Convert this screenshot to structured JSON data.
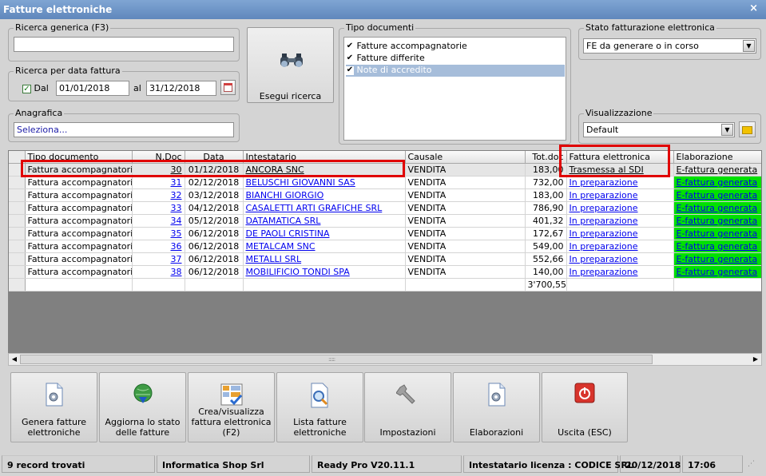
{
  "window": {
    "title": "Fatture elettroniche",
    "close_glyph": "×"
  },
  "search": {
    "generic_label": "Ricerca generica (F3)",
    "generic_value": "",
    "date_label": "Ricerca per data fattura",
    "date_from_label": "Dal",
    "date_from_checked": true,
    "date_from": "01/01/2018",
    "date_to_label": "al",
    "date_to": "31/12/2018",
    "anagrafica_label": "Anagrafica",
    "anagrafica_value": "Seleziona...",
    "search_button": "Esegui ricerca"
  },
  "tipo_documenti": {
    "label": "Tipo documenti",
    "items": [
      {
        "label": "Fatture accompagnatorie",
        "checked": true,
        "selected": false
      },
      {
        "label": "Fatture differite",
        "checked": true,
        "selected": false
      },
      {
        "label": "Note di accredito",
        "checked": true,
        "selected": true
      }
    ]
  },
  "stato": {
    "label": "Stato fatturazione elettronica",
    "value": "FE da generare o in corso"
  },
  "visualizzazione": {
    "label": "Visualizzazione",
    "value": "Default"
  },
  "grid": {
    "columns": [
      "Tipo documento",
      "N.Doc",
      "Data",
      "Intestatario",
      "Causale",
      "Tot.doc",
      "Fattura elettronica",
      "Elaborazione"
    ],
    "rows": [
      {
        "tipo": "Fattura accompagnatoria",
        "ndoc": "30",
        "data": "01/12/2018",
        "intestatario": "ANCORA SNC",
        "causale": "VENDITA",
        "tot": "183,00",
        "fe": "Trasmessa al SDI",
        "elab": "E-fattura generata"
      },
      {
        "tipo": "Fattura accompagnatoria",
        "ndoc": "31",
        "data": "02/12/2018",
        "intestatario": "BELUSCHI GIOVANNI SAS",
        "causale": "VENDITA",
        "tot": "732,00",
        "fe": "In preparazione",
        "elab": "E-fattura generata"
      },
      {
        "tipo": "Fattura accompagnatoria",
        "ndoc": "32",
        "data": "03/12/2018",
        "intestatario": "BIANCHI GIORGIO",
        "causale": "VENDITA",
        "tot": "183,00",
        "fe": "In preparazione",
        "elab": "E-fattura generata"
      },
      {
        "tipo": "Fattura accompagnatoria",
        "ndoc": "33",
        "data": "04/12/2018",
        "intestatario": "CASALETTI ARTI GRAFICHE SRL",
        "causale": "VENDITA",
        "tot": "786,90",
        "fe": "In preparazione",
        "elab": "E-fattura generata"
      },
      {
        "tipo": "Fattura accompagnatoria",
        "ndoc": "34",
        "data": "05/12/2018",
        "intestatario": "DATAMATICA SRL",
        "causale": "VENDITA",
        "tot": "401,32",
        "fe": "In preparazione",
        "elab": "E-fattura generata"
      },
      {
        "tipo": "Fattura accompagnatoria",
        "ndoc": "35",
        "data": "06/12/2018",
        "intestatario": "DE PAOLI CRISTINA",
        "causale": "VENDITA",
        "tot": "172,67",
        "fe": "In preparazione",
        "elab": "E-fattura generata"
      },
      {
        "tipo": "Fattura accompagnatoria",
        "ndoc": "36",
        "data": "06/12/2018",
        "intestatario": "METALCAM SNC",
        "causale": "VENDITA",
        "tot": "549,00",
        "fe": "In preparazione",
        "elab": "E-fattura generata"
      },
      {
        "tipo": "Fattura accompagnatoria",
        "ndoc": "37",
        "data": "06/12/2018",
        "intestatario": "METALLI SRL",
        "causale": "VENDITA",
        "tot": "552,66",
        "fe": "In preparazione",
        "elab": "E-fattura generata"
      },
      {
        "tipo": "Fattura accompagnatoria",
        "ndoc": "38",
        "data": "06/12/2018",
        "intestatario": "MOBILIFICIO TONDI SPA",
        "causale": "VENDITA",
        "tot": "140,00",
        "fe": "In preparazione",
        "elab": "E-fattura generata"
      }
    ],
    "total": "3'700,55"
  },
  "toolbar": [
    {
      "name": "genera-fatture-button",
      "icon": "gear-document-icon",
      "label": "Genera fatture\nelettroniche"
    },
    {
      "name": "aggiorna-stato-button",
      "icon": "globe-download-icon",
      "label": "Aggiorna lo stato\ndelle fatture"
    },
    {
      "name": "crea-visualizza-button",
      "icon": "checklist-icon",
      "label": "Crea/visualizza\nfattura elettronica\n(F2)"
    },
    {
      "name": "lista-fatture-button",
      "icon": "document-search-icon",
      "label": "Lista fatture\nelettroniche"
    },
    {
      "name": "impostazioni-button",
      "icon": "wrench-icon",
      "label": "Impostazioni"
    },
    {
      "name": "elaborazioni-button",
      "icon": "gear-document-icon",
      "label": "Elaborazioni"
    },
    {
      "name": "uscita-button",
      "icon": "power-icon",
      "label": "Uscita (ESC)"
    }
  ],
  "status": {
    "records": "9 record trovati",
    "company": "Informatica Shop Srl",
    "version": "Ready Pro V20.11.1",
    "license": "Intestatario licenza : CODICE SRL",
    "date": "20/12/2018",
    "time": "17:06"
  },
  "colors": {
    "title": "#6a92c6",
    "green": "#00e000",
    "highlight": "#e00000"
  }
}
